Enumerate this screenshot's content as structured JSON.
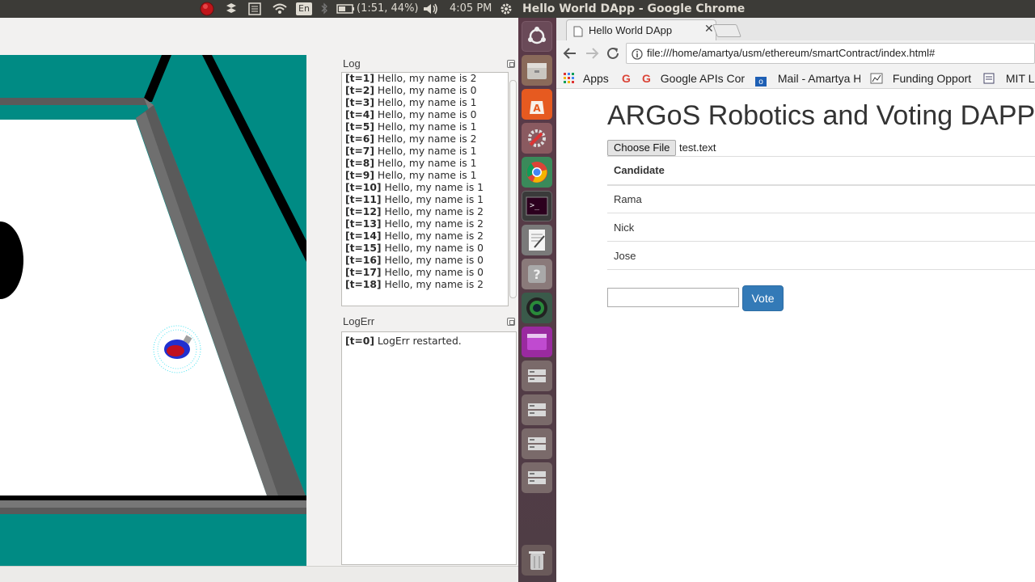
{
  "top_panel": {
    "keyboard_layout": "En",
    "battery": "(1:51, 44%)",
    "clock": "4:05 PM",
    "window_title": "Hello World DApp - Google Chrome"
  },
  "argos": {
    "log_title": "Log",
    "log_lines": [
      {
        "t": "[t=1]",
        "msg": "Hello, my name is 2"
      },
      {
        "t": "[t=2]",
        "msg": "Hello, my name is 0"
      },
      {
        "t": "[t=3]",
        "msg": "Hello, my name is 1"
      },
      {
        "t": "[t=4]",
        "msg": "Hello, my name is 0"
      },
      {
        "t": "[t=5]",
        "msg": "Hello, my name is 1"
      },
      {
        "t": "[t=6]",
        "msg": "Hello, my name is 2"
      },
      {
        "t": "[t=7]",
        "msg": "Hello, my name is 1"
      },
      {
        "t": "[t=8]",
        "msg": "Hello, my name is 1"
      },
      {
        "t": "[t=9]",
        "msg": "Hello, my name is 1"
      },
      {
        "t": "[t=10]",
        "msg": "Hello, my name is 1"
      },
      {
        "t": "[t=11]",
        "msg": "Hello, my name is 1"
      },
      {
        "t": "[t=12]",
        "msg": "Hello, my name is 2"
      },
      {
        "t": "[t=13]",
        "msg": "Hello, my name is 2"
      },
      {
        "t": "[t=14]",
        "msg": "Hello, my name is 2"
      },
      {
        "t": "[t=15]",
        "msg": "Hello, my name is 0"
      },
      {
        "t": "[t=16]",
        "msg": "Hello, my name is 0"
      },
      {
        "t": "[t=17]",
        "msg": "Hello, my name is 0"
      },
      {
        "t": "[t=18]",
        "msg": "Hello, my name is 2"
      }
    ],
    "logerr_title": "LogErr",
    "logerr_lines": [
      {
        "t": "[t=0]",
        "msg": "LogErr restarted."
      }
    ],
    "colors": {
      "arena_floor": "#008b84",
      "wall": "#5a5a5a"
    }
  },
  "chrome": {
    "tab_title": "Hello World DApp",
    "url": "file:///home/amartya/usm/ethereum/smartContract/index.html#",
    "bookmarks": [
      "Apps",
      "",
      "Google APIs Cor",
      "Mail - Amartya H",
      "Funding Opport",
      "MIT Li"
    ]
  },
  "page": {
    "heading": "ARGoS Robotics and Voting DAPP",
    "choose_file_label": "Choose File",
    "file_name": "test.text",
    "table_header": "Candidate",
    "candidates": [
      "Rama",
      "Nick",
      "Jose"
    ],
    "vote_input_value": "",
    "vote_label": "Vote",
    "colors": {
      "vote_button": "#337ab7"
    }
  }
}
